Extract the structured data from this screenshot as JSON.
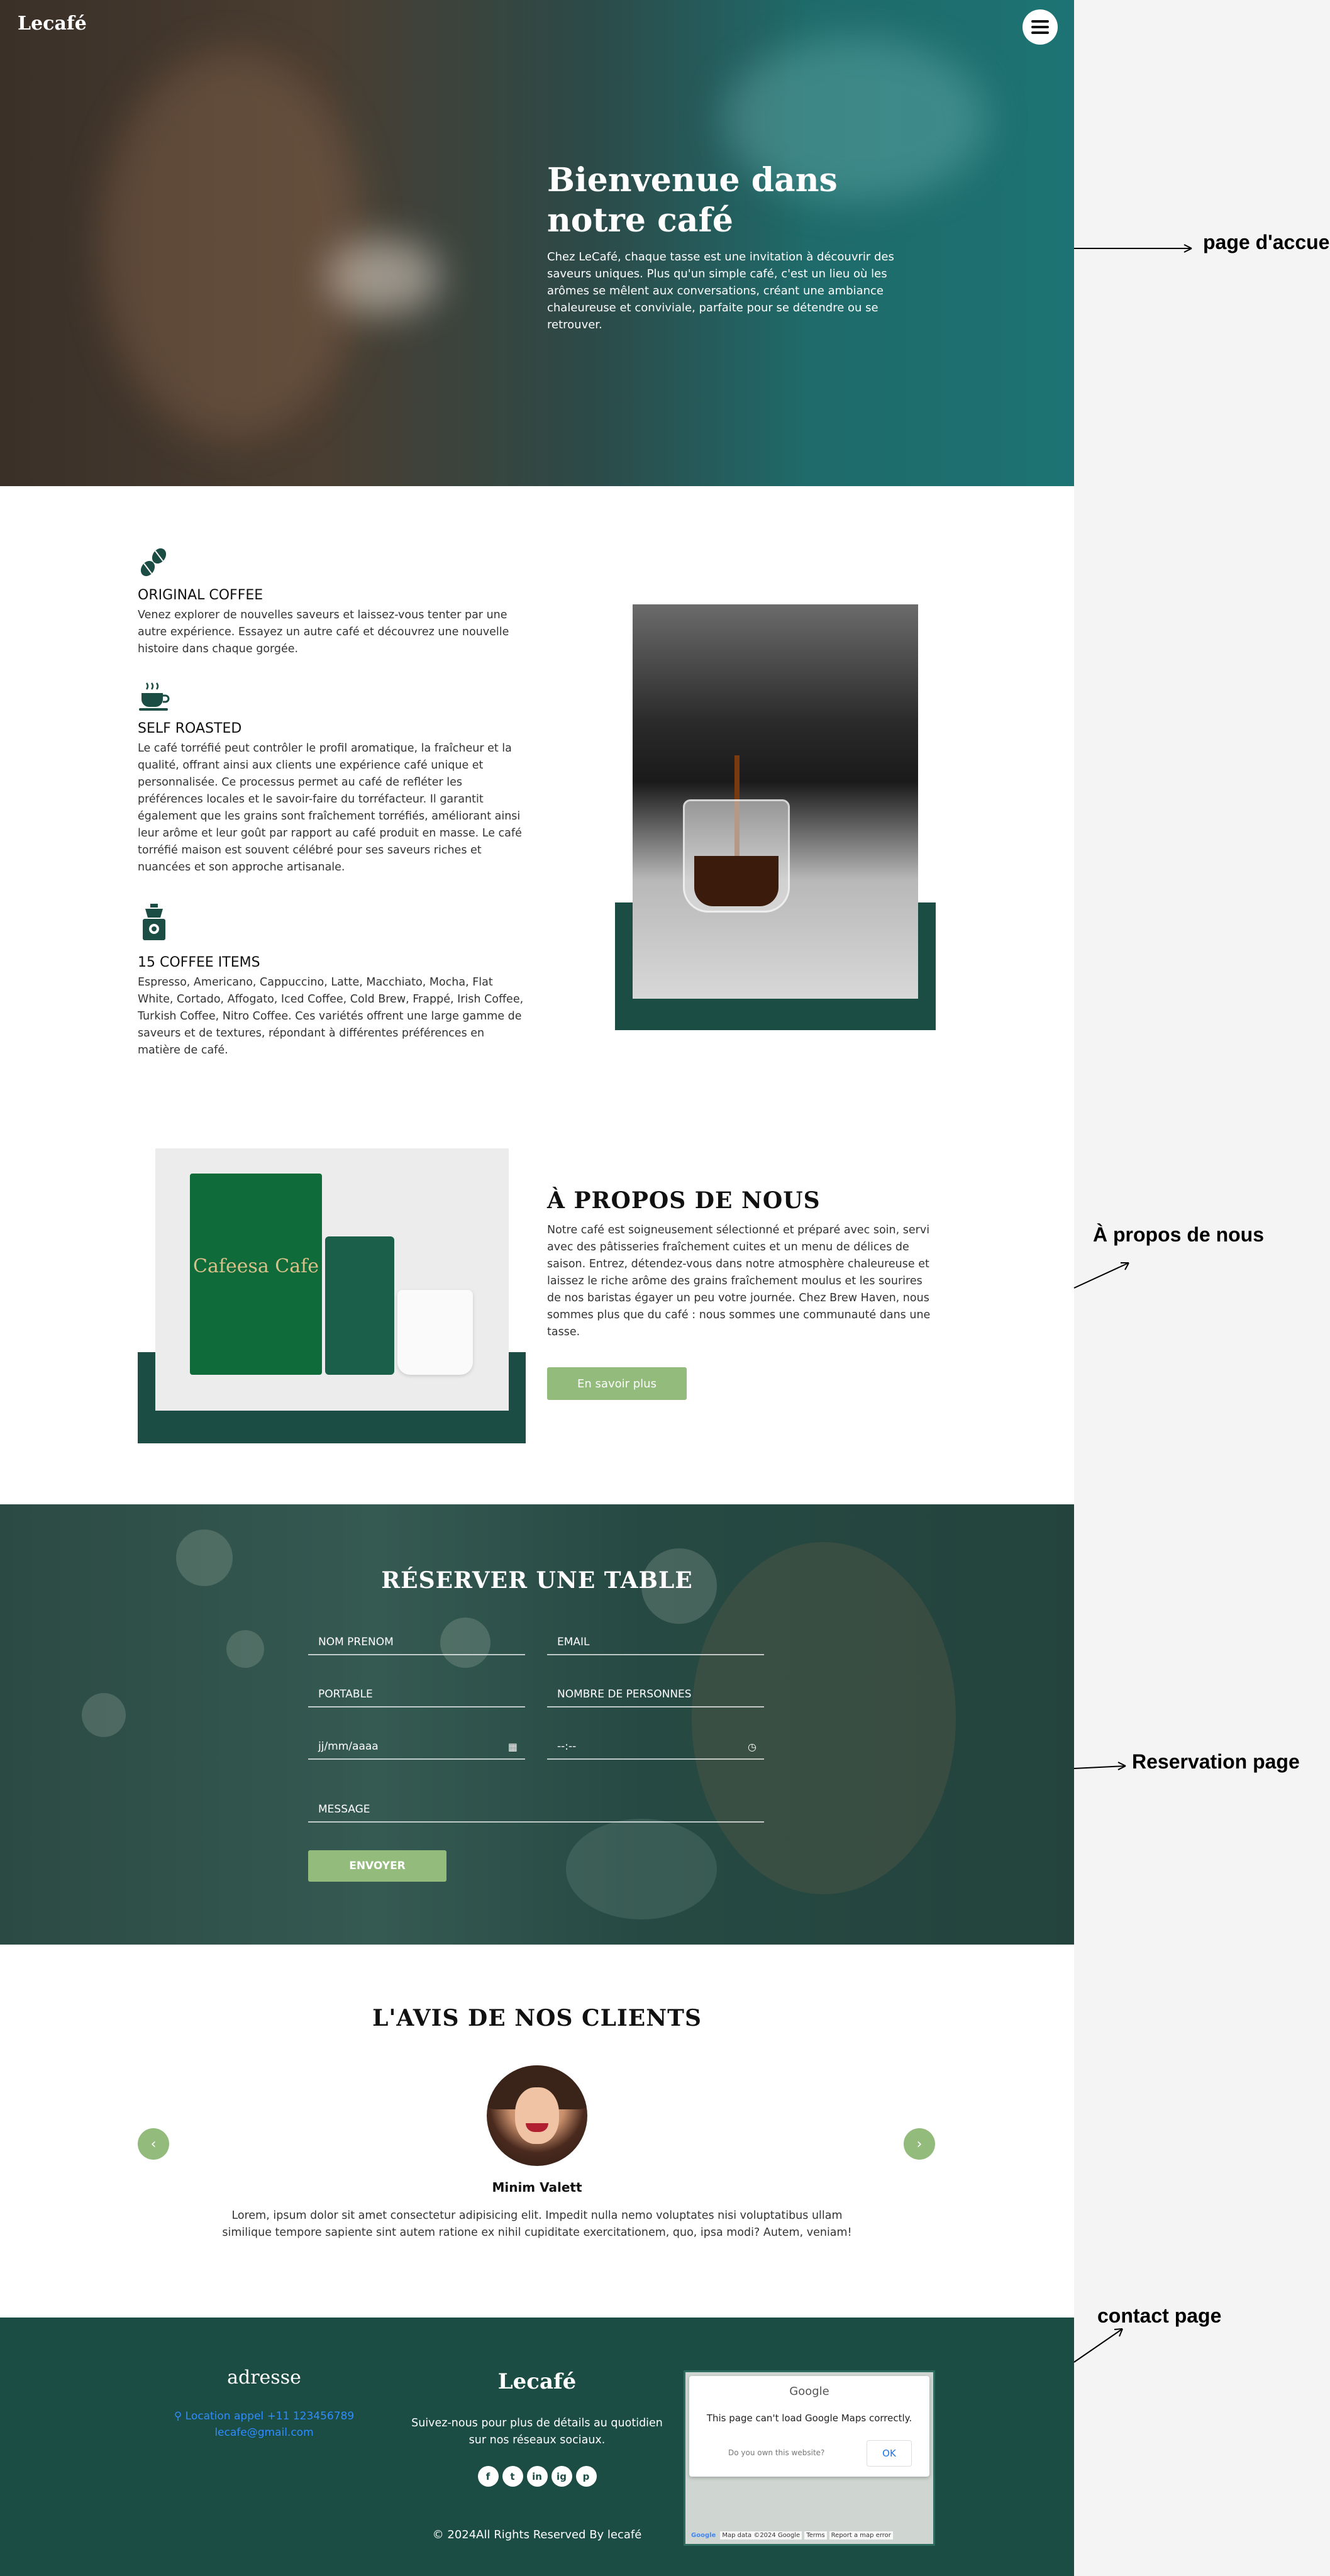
{
  "header": {
    "logo": "Lecafé",
    "menu_icon": "hamburger-menu-icon"
  },
  "hero": {
    "title": "Bienvenue dans notre café",
    "text": "Chez LeCafé, chaque tasse est une invitation à découvrir des saveurs uniques. Plus qu'un simple café, c'est un lieu où les arômes se mêlent aux conversations, créant une ambiance chaleureuse et conviviale, parfaite pour se détendre ou se retrouver."
  },
  "features": [
    {
      "icon": "coffee-beans-icon",
      "title": "ORIGINAL COFFEE",
      "text": "Venez explorer de nouvelles saveurs et laissez-vous tenter par une autre expérience. Essayez un autre café et découvrez une nouvelle histoire dans chaque gorgée."
    },
    {
      "icon": "coffee-cup-icon",
      "title": "SELF ROASTED",
      "text": "Le café torréfié peut contrôler le profil aromatique, la fraîcheur et la qualité, offrant ainsi aux clients une expérience café unique et personnalisée. Ce processus permet au café de refléter les préférences locales et le savoir-faire du torréfacteur. Il garantit également que les grains sont fraîchement torréfiés, améliorant ainsi leur arôme et leur goût par rapport au café produit en masse. Le café torréfié maison est souvent célébré pour ses saveurs riches et nuancées et son approche artisanale."
    },
    {
      "icon": "coffee-grinder-icon",
      "title": "15 COFFEE ITEMS",
      "text": "Espresso, Americano, Cappuccino, Latte, Macchiato, Mocha, Flat White, Cortado, Affogato, Iced Coffee, Cold Brew, Frappé, Irish Coffee, Turkish Coffee, Nitro Coffee. Ces variétés offrent une large gamme de saveurs et de textures, répondant à différentes préférences en matière de café."
    }
  ],
  "about": {
    "bag_text": "Cafeesa Cafe",
    "title": "À PROPOS DE NOUS",
    "text": "Notre café est soigneusement sélectionné et préparé avec soin, servi avec des pâtisseries fraîchement cuites et un menu de délices de saison. Entrez, détendez-vous dans notre atmosphère chaleureuse et laissez le riche arôme des grains fraîchement moulus et les sourires de nos baristas égayer un peu votre journée. Chez Brew Haven, nous sommes plus que du café : nous sommes une communauté dans une tasse.",
    "button": "En savoir plus"
  },
  "reservation": {
    "title": "RÉSERVER UNE TABLE",
    "fields": {
      "name": "NOM PRENOM",
      "email": "EMAIL",
      "phone": "PORTABLE",
      "people": "NOMBRE DE PERSONNES",
      "date": "jj/mm/aaaa",
      "time": "--:--",
      "message": "MESSAGE"
    },
    "submit": "ENVOYER"
  },
  "testimonials": {
    "title": "L'AVIS DE NOS CLIENTS",
    "name": "Minim Valett",
    "text": "Lorem, ipsum dolor sit amet consectetur adipisicing elit. Impedit nulla nemo voluptates nisi voluptatibus ullam similique tempore sapiente sint autem ratione ex nihil cupiditate exercitationem, quo, ipsa modi? Autem, veniam!",
    "prev": "‹",
    "next": "›"
  },
  "footer": {
    "address_title": "adresse",
    "contact_line": "Location appel +11 123456789",
    "email": "lecafe@gmail.com",
    "logo": "Lecafé",
    "text": "Suivez-nous pour plus de détails au quotidien sur nos réseaux sociaux.",
    "socials": [
      "f",
      "t",
      "in",
      "ig",
      "p"
    ],
    "map": {
      "brand": "Google",
      "message": "This page can't load Google Maps correctly.",
      "own": "Do you own this website?",
      "ok": "OK",
      "bar": [
        "Google",
        "Map data ©2024 Google",
        "Terms",
        "Report a map error"
      ]
    },
    "copyright": "© 2024All Rights Reserved By lecafé"
  },
  "annotations": {
    "home": "page d'accueil",
    "about": "À propos de nous",
    "reservation": "Reservation page",
    "contact": "contact page"
  }
}
